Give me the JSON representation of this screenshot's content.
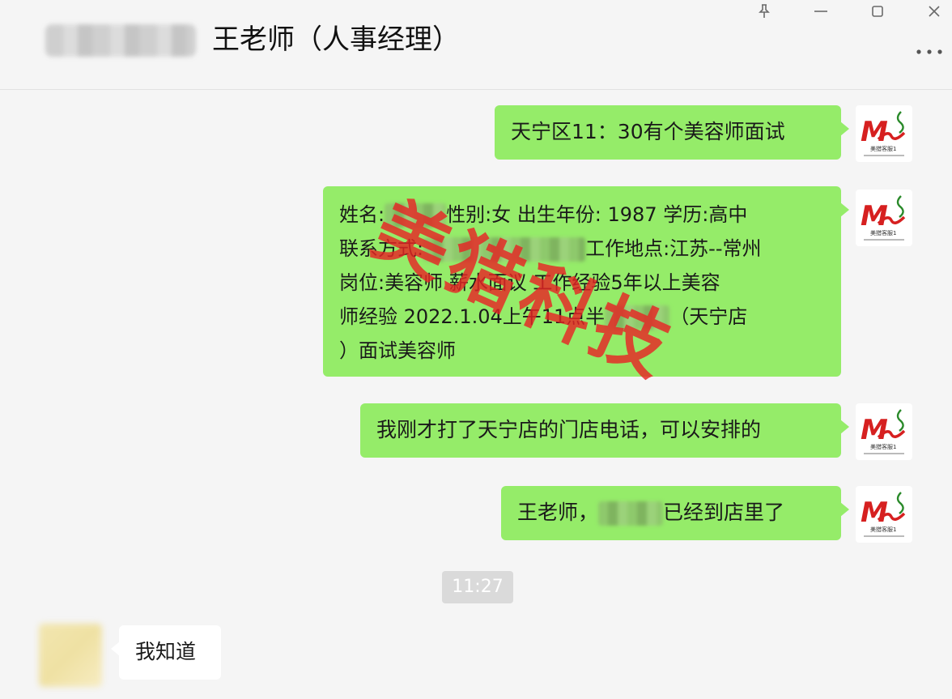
{
  "header": {
    "chat_title": "王老师（人事经理）",
    "more_label": "···",
    "pin_label": "⌖",
    "minimize_label": "—",
    "maximize_label": "▢",
    "close_label": "✕"
  },
  "messages": {
    "m1": "天宁区11：30有个美容师面试",
    "m2": {
      "l1a": "姓名:",
      "l1b": "性别:女 出生年份: 1987 学历:高中",
      "l2a": "联系方式:",
      "l2b": "工作地点:江苏--常州",
      "l3": "岗位:美容师 薪水面议 工作经验5年以上美容",
      "l4a": "师经验 2022.1.04上午11点半",
      "l4b": "（天宁店",
      "l5": "）面试美容师"
    },
    "m3": "我刚才打了天宁店的门店电话，可以安排的",
    "m4a": "王老师，",
    "m4b": "已经到店里了",
    "time": "11:27",
    "m5": "我知道"
  },
  "avatar_logo": {
    "mark": "M",
    "caption": "美猎客服1"
  },
  "watermark": "美猎科技",
  "colors": {
    "bubble_out": "#95ec69",
    "bubble_in": "#ffffff",
    "watermark": "#e72424",
    "logo_red": "#d62020",
    "logo_green": "#2a8a2a"
  }
}
